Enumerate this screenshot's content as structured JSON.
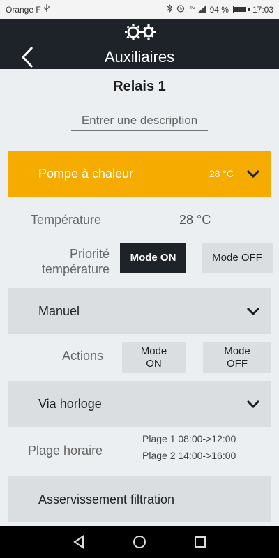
{
  "status_bar": {
    "carrier": "Orange F",
    "usb_icon": "usb-icon",
    "bluetooth_icon": "bluetooth-icon",
    "alarm_icon": "alarm-icon",
    "network": "4G",
    "battery_pct": "94 %",
    "battery_level": 0.94,
    "time": "17:03"
  },
  "appbar": {
    "title": "Auxiliaires",
    "logo_icon": "gears-icon",
    "back_icon": "back-chevron-icon"
  },
  "relais": {
    "title": "Relais 1",
    "description_placeholder": "Entrer une description"
  },
  "pompe": {
    "label": "Pompe à chaleur",
    "value": "28 °C",
    "color": "#f5ab00"
  },
  "temperature": {
    "label": "Température",
    "value": "28 °C"
  },
  "priorite": {
    "label_line1": "Priorité",
    "label_line2": "température",
    "mode_on": "Mode ON",
    "mode_off": "Mode OFF"
  },
  "manuel": {
    "label": "Manuel"
  },
  "actions": {
    "label": "Actions",
    "mode_on_line1": "Mode",
    "mode_on_line2": "ON",
    "mode_off_line1": "Mode",
    "mode_off_line2": "OFF"
  },
  "horloge": {
    "label": "Via horloge"
  },
  "plage": {
    "label": "Plage horaire",
    "plage1": "Plage 1 08:00->12:00",
    "plage2": "Plage 2 14:00->16:00"
  },
  "asservissement": {
    "label": "Asservissement filtration"
  },
  "nav": {
    "back": "nav-back-icon",
    "home": "nav-home-icon",
    "recents": "nav-recents-icon"
  },
  "colors": {
    "appbar": "#1e232a",
    "accent": "#f5ab00",
    "background": "#eceff1",
    "section": "#dadee1"
  }
}
